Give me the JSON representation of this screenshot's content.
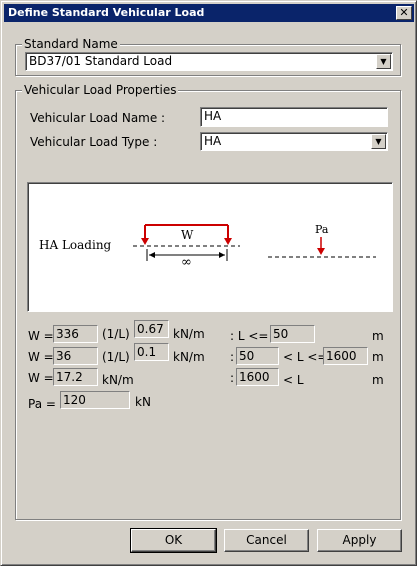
{
  "window": {
    "title": "Define Standard Vehicular Load",
    "close_glyph": "✕"
  },
  "standard_name": {
    "group_label": "Standard Name",
    "selected": "BD37/01 Standard Load"
  },
  "properties": {
    "group_label": "Vehicular Load Properties",
    "name_label": "Vehicular Load Name :",
    "name_value": "HA",
    "type_label": "Vehicular Load Type :",
    "type_value": "HA"
  },
  "diagram": {
    "ha_label": "HA Loading",
    "w_label": "W",
    "infinity_label": "∞",
    "pa_label": "Pa"
  },
  "rows": [
    {
      "w_label": "W =",
      "w_value": "336",
      "l_label": "(1/L)",
      "exp_value": "0.67",
      "unit": "kN/m",
      "cond_pre": ": L <=",
      "cond_value": "50",
      "cond_unit": "m"
    },
    {
      "w_label": "W =",
      "w_value": "36",
      "l_label": "(1/L)",
      "exp_value": "0.1",
      "unit": "kN/m",
      "cond_lo": "50",
      "cond_mid": "< L <=",
      "cond_hi": "1600",
      "cond_unit": "m"
    },
    {
      "w_label": "W =",
      "w_value": "17.2",
      "unit": "kN/m",
      "cond_value": "1600",
      "cond_post": "< L",
      "cond_unit": "m"
    }
  ],
  "pa": {
    "label": "Pa =",
    "value": "120",
    "unit": "kN"
  },
  "buttons": {
    "ok": "OK",
    "cancel": "Cancel",
    "apply": "Apply"
  },
  "colors": {
    "titlebar": "#0a246a",
    "face": "#d4d0c8",
    "load_arrow": "#cc0000"
  }
}
